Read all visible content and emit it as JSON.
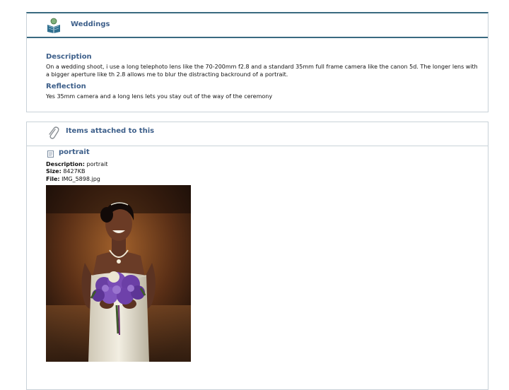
{
  "colors": {
    "heading": "#3d5f8a",
    "rule": "#3a6a80",
    "border": "#c9d2d8"
  },
  "entry": {
    "title": "Weddings",
    "icon": "book-reader-icon",
    "description_label": "Description",
    "description_text": "On a wedding shoot, i use a long telephoto lens like the 70-200mm f2.8 and a standard 35mm full frame camera like the canon 5d. The longer lens with a bigger aperture like th 2.8 allows me to blur the distracting backround of a portrait.",
    "reflection_label": "Reflection",
    "reflection_text": "Yes 35mm camera and a long lens lets you stay out of the way of the ceremony"
  },
  "attachments": {
    "title": "Items attached to this",
    "icon": "paperclip-icon",
    "items": [
      {
        "icon": "file-icon",
        "name": "portrait",
        "description_label": "Description:",
        "description": "portrait",
        "size_label": "Size:",
        "size": "8427KB",
        "file_label": "File:",
        "file": "IMG_5898.jpg",
        "image": "photo-of-bride-holding-purple-bouquet"
      }
    ]
  }
}
